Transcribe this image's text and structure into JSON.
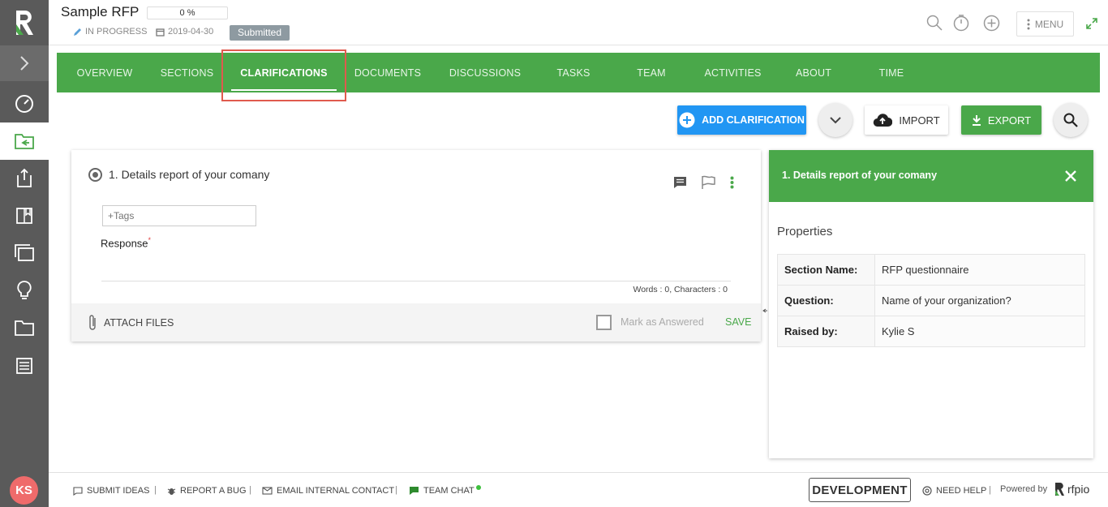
{
  "header": {
    "title": "Sample RFP",
    "progress": "0 %",
    "status": "IN PROGRESS",
    "due_date": "2019-04-30",
    "badge": "Submitted",
    "menu_label": "MENU"
  },
  "tabs": [
    "OVERVIEW",
    "SECTIONS",
    "CLARIFICATIONS",
    "DOCUMENTS",
    "DISCUSSIONS",
    "TASKS",
    "TEAM",
    "ACTIVITIES",
    "ABOUT",
    "TIME"
  ],
  "active_tab": "CLARIFICATIONS",
  "toolbar": {
    "add_label": "ADD CLARIFICATION",
    "import_label": "IMPORT",
    "export_label": "EXPORT"
  },
  "question": {
    "title": "1. Details report of your comany",
    "tags_placeholder": "+Tags",
    "response_label": "Response",
    "required_mark": "*",
    "counts": "Words : 0, Characters : 0",
    "attach_label": "ATTACH FILES",
    "mark_answered_label": "Mark as Answered",
    "save_label": "SAVE"
  },
  "panel": {
    "title": "1. Details report of your comany",
    "properties_heading": "Properties",
    "properties": [
      {
        "key": "Section Name:",
        "value": "RFP questionnaire"
      },
      {
        "key": "Question:",
        "value": "Name of your organization?"
      },
      {
        "key": "Raised by:",
        "value": "Kylie S"
      }
    ]
  },
  "footer": {
    "submit_ideas": "SUBMIT IDEAS",
    "report_bug": "REPORT A BUG",
    "email_contact": "EMAIL INTERNAL CONTACT",
    "team_chat": "TEAM CHAT",
    "environment": "DEVELOPMENT",
    "need_help": "NEED HELP",
    "powered_by": "Powered by",
    "brand": "rfpio"
  },
  "user": {
    "initials": "KS"
  },
  "colors": {
    "brand_green": "#4aa84a",
    "sidebar": "#5a5a5a",
    "primary_blue": "#2196f3",
    "avatar": "#ef6b6b"
  }
}
